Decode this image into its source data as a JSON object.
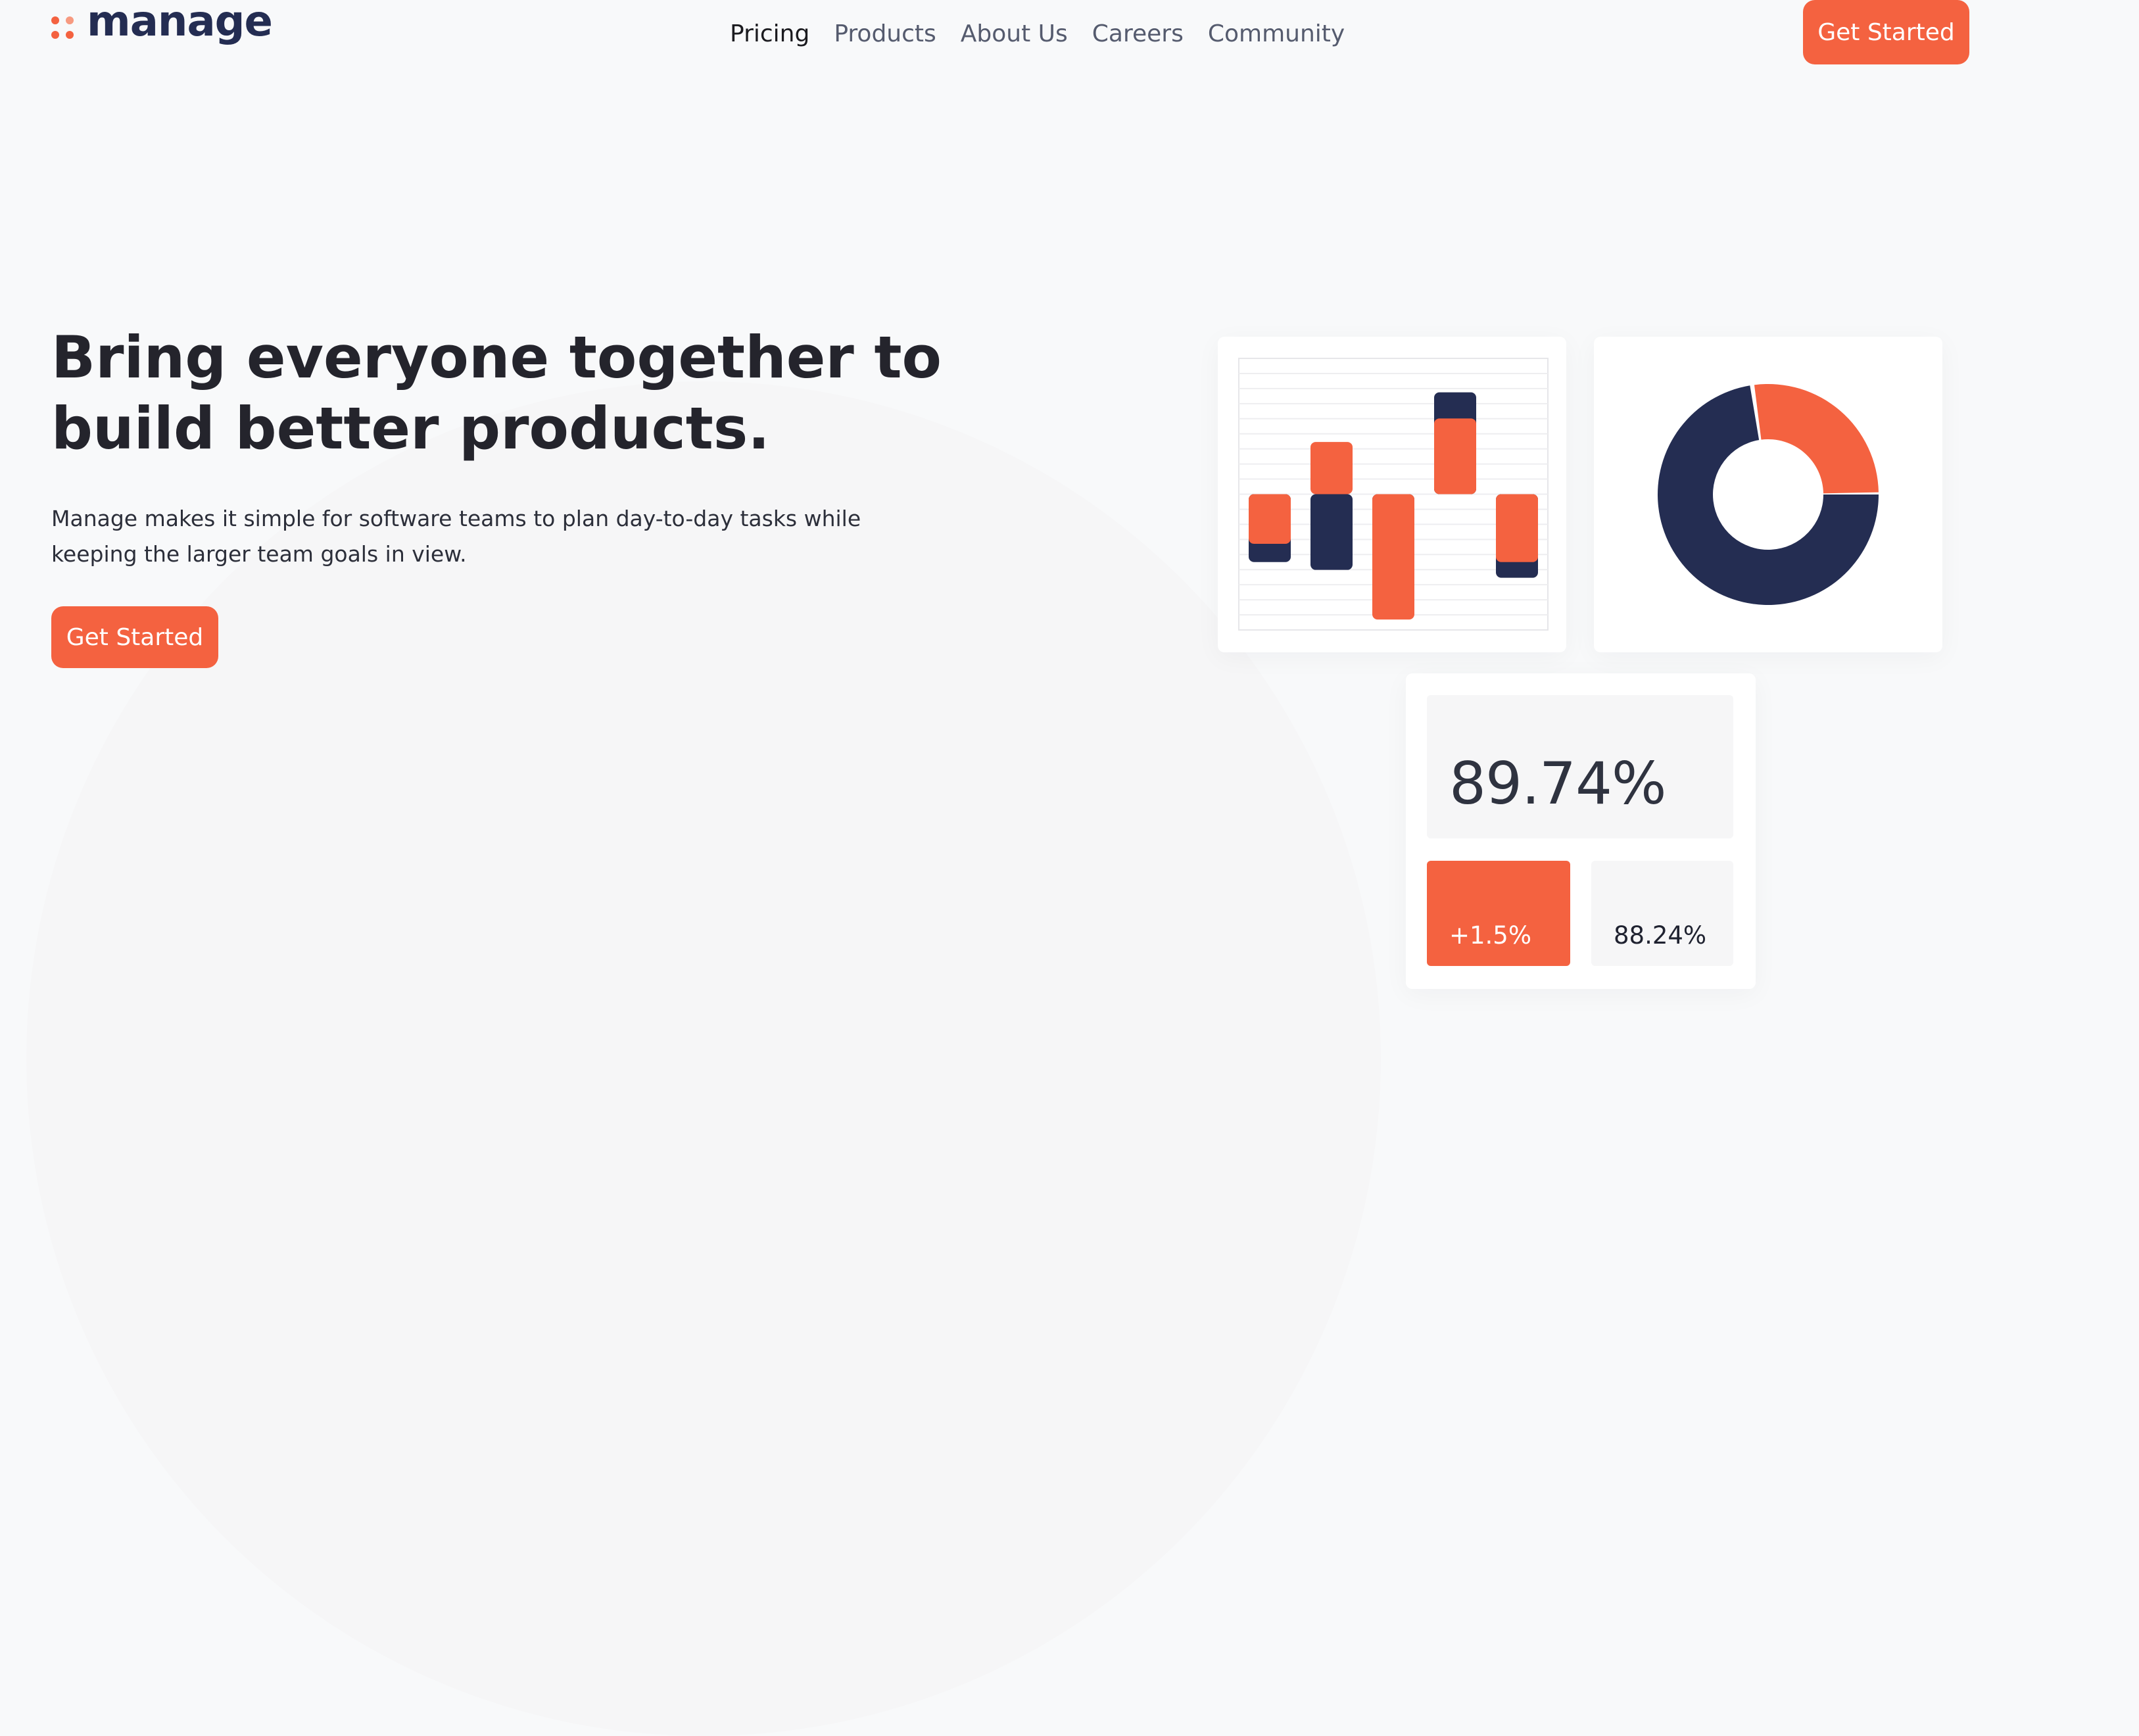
{
  "brand": {
    "name": "manage"
  },
  "nav": {
    "items": [
      {
        "label": "Pricing",
        "active": true
      },
      {
        "label": "Products",
        "active": false
      },
      {
        "label": "About Us",
        "active": false
      },
      {
        "label": "Careers",
        "active": false
      },
      {
        "label": "Community",
        "active": false
      }
    ],
    "cta_label": "Get Started"
  },
  "hero": {
    "title_line1": "Bring everyone together to",
    "title_line2": "build better products.",
    "description_line1": "Manage makes it simple for software teams to plan day-to-day tasks while",
    "description_line2": "keeping the larger team goals in view.",
    "cta_label": "Get Started"
  },
  "stats": {
    "main": "89.74%",
    "change": "+1.5%",
    "secondary": "88.24%"
  },
  "colors": {
    "accent": "#f46240",
    "navy": "#242d52",
    "background": "#f8f9fa",
    "card": "#ffffff"
  },
  "chart_data": [
    {
      "type": "bar",
      "categories": [
        "",
        "",
        "",
        "",
        ""
      ],
      "series": [
        {
          "color": "#242d52",
          "values": [
            -1.3,
            -1.45,
            -0.95,
            1.95,
            -1.6
          ]
        },
        {
          "color": "#f46240",
          "values": [
            -0.95,
            1.0,
            -2.4,
            1.45,
            -1.3
          ]
        }
      ],
      "ylim": [
        -2.6,
        2.6
      ],
      "grid": true
    },
    {
      "type": "pie",
      "variant": "donut",
      "slices": [
        {
          "color": "#f46240",
          "value": 27
        },
        {
          "color": "#242d52",
          "value": 73
        }
      ]
    }
  ]
}
